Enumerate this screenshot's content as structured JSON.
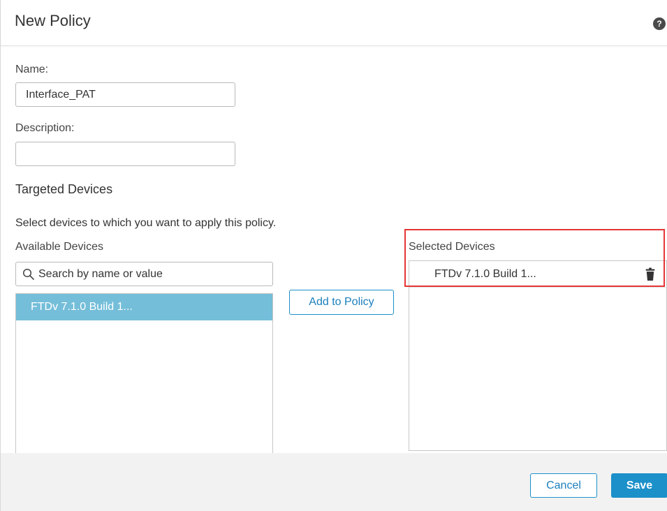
{
  "dialog": {
    "title": "New Policy",
    "help_icon": "question-circle-icon",
    "help_glyph": "?"
  },
  "form": {
    "name_label": "Name:",
    "name_value": "Interface_PAT",
    "description_label": "Description:",
    "description_value": ""
  },
  "targeting": {
    "section_title": "Targeted Devices",
    "instruction": "Select devices to which you want to apply this policy.",
    "available": {
      "header": "Available Devices",
      "search_placeholder": "Search by name or value",
      "search_icon": "magnifier-icon",
      "items": [
        "FTDv 7.1.0 Build 1..."
      ],
      "selected_color": "#74bed9"
    },
    "add_button_label": "Add to Policy",
    "selected": {
      "header": "Selected Devices",
      "items": [
        "FTDv 7.1.0 Build 1..."
      ],
      "remove_icon": "trash-icon"
    },
    "highlight_color": "#e53535"
  },
  "footer": {
    "cancel_label": "Cancel",
    "save_label": "Save",
    "accent_color": "#1b90c9"
  }
}
